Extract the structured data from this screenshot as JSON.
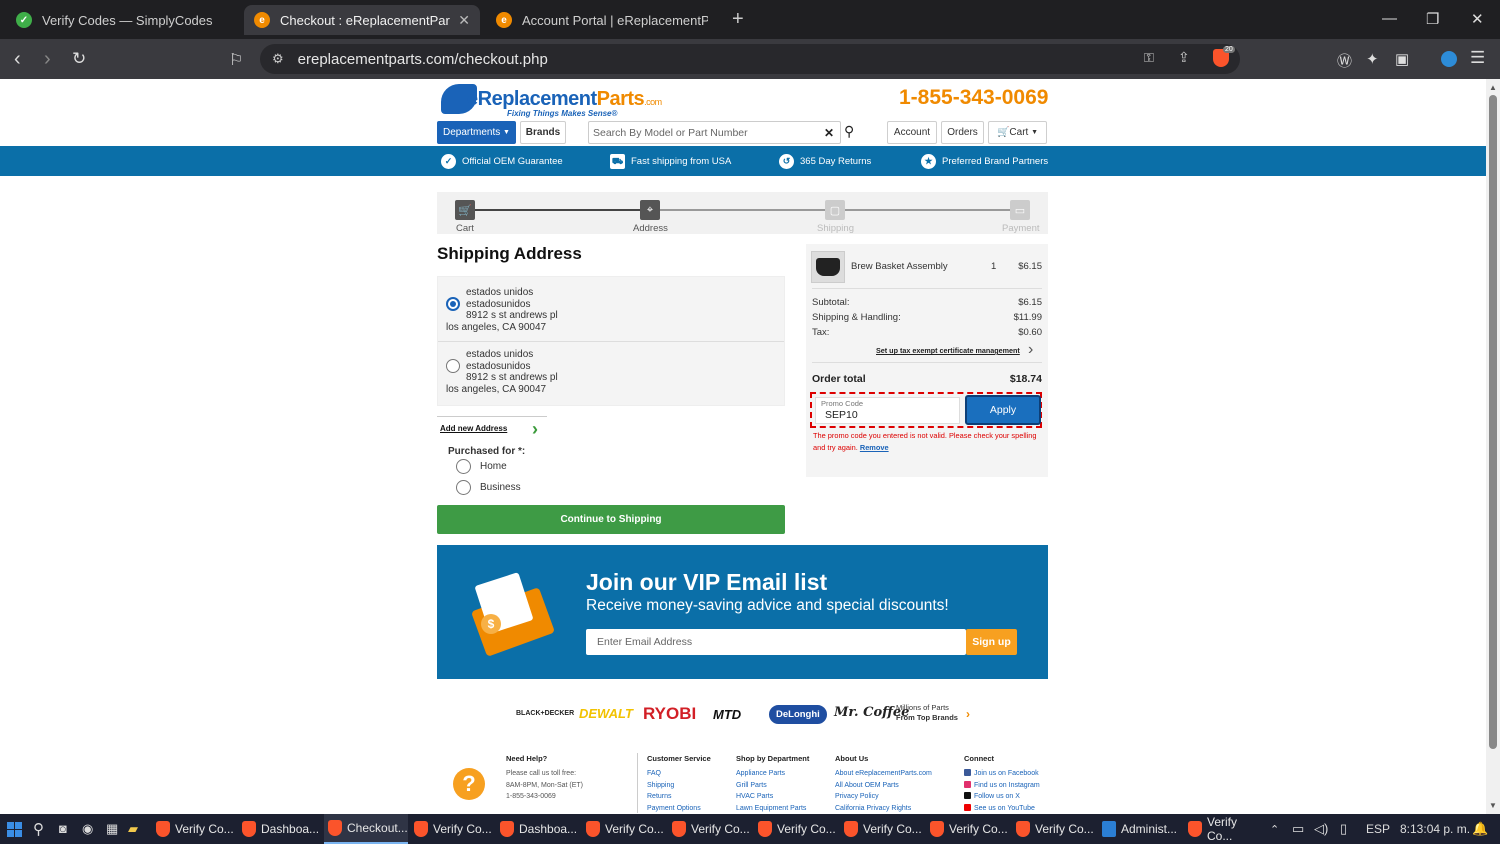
{
  "browser": {
    "tabs": [
      {
        "title": "Verify Codes — SimplyCodes",
        "active": false
      },
      {
        "title": "Checkout : eReplacementParts.c",
        "active": true
      },
      {
        "title": "Account Portal | eReplacementParts.c",
        "active": false
      }
    ],
    "url": "ereplacementparts.com/checkout.php",
    "shield_count": "20"
  },
  "header": {
    "logo_main": "eReplacement",
    "logo_parts": "Parts",
    "logo_com": ".com",
    "logo_tagline": "Fixing Things Makes Sense®",
    "phone": "1-855-343-0069",
    "departments_label": "Departments",
    "brands_label": "Brands",
    "search_placeholder": "Search By Model or Part Number",
    "account_label": "Account",
    "orders_label": "Orders",
    "cart_label": "Cart"
  },
  "benefits": [
    "Official OEM Guarantee",
    "Fast shipping from USA",
    "365 Day Returns",
    "Preferred Brand Partners"
  ],
  "steps": [
    "Cart",
    "Address",
    "Shipping",
    "Payment"
  ],
  "shipping": {
    "heading": "Shipping Address",
    "addresses": [
      {
        "line1": "estados unidos",
        "line2": "estadosunidos",
        "line3": "8912 s st andrews pl",
        "line4": "los angeles, CA 90047",
        "selected": true
      },
      {
        "line1": "estados unidos",
        "line2": "estadosunidos",
        "line3": "8912 s st andrews pl",
        "line4": "los angeles, CA 90047",
        "selected": false
      }
    ],
    "add_new": "Add new Address",
    "purchased_for": "Purchased for *:",
    "options": [
      "Home",
      "Business"
    ],
    "continue_label": "Continue to Shipping"
  },
  "summary": {
    "item_name": "Brew Basket Assembly",
    "item_qty": "1",
    "item_price": "$6.15",
    "subtotal_label": "Subtotal:",
    "subtotal": "$6.15",
    "shipping_label": "Shipping & Handling:",
    "shipping": "$11.99",
    "tax_label": "Tax:",
    "tax": "$0.60",
    "tax_link": "Set up tax exempt certificate management",
    "total_label": "Order total",
    "total": "$18.74",
    "promo_label": "Promo Code",
    "promo_value": "SEP10",
    "apply_label": "Apply",
    "promo_error": "The promo code you entered is not valid. Please check your spelling and try again.",
    "remove_label": "Remove"
  },
  "vip": {
    "heading": "Join our VIP Email list",
    "subheading": "Receive money-saving advice and special discounts!",
    "email_placeholder": "Enter Email Address",
    "signup_label": "Sign up"
  },
  "brands": {
    "names": [
      "BLACK+DECKER",
      "DEWALT",
      "RYOBI",
      "MTD",
      "DeLonghi",
      "Mr. Coffee"
    ],
    "tagline1": "Millions of Parts",
    "tagline2": "From Top Brands"
  },
  "footer": {
    "help_title": "Need Help?",
    "help_lines": [
      "Please call us toll free:",
      "8AM-8PM, Mon-Sat (ET)",
      "1-855-343-0069"
    ],
    "customer_service": {
      "title": "Customer Service",
      "links": [
        "FAQ",
        "Shipping",
        "Returns",
        "Payment Options"
      ]
    },
    "shop": {
      "title": "Shop by Department",
      "links": [
        "Appliance Parts",
        "Grill Parts",
        "HVAC Parts",
        "Lawn Equipment Parts"
      ]
    },
    "about": {
      "title": "About Us",
      "links": [
        "About eReplacementParts.com",
        "All About OEM Parts",
        "Privacy Policy",
        "California Privacy Rights"
      ]
    },
    "connect": {
      "title": "Connect",
      "links": [
        "Join us on Facebook",
        "Find us on Instagram",
        "Follow us on X",
        "See us on YouTube"
      ]
    }
  },
  "taskbar": {
    "apps": [
      "Verify Co...",
      "Dashboa...",
      "Checkout...",
      "Verify Co...",
      "Dashboa...",
      "Verify Co...",
      "Verify Co...",
      "Verify Co...",
      "Verify Co...",
      "Verify Co...",
      "Verify Co...",
      "Administ...",
      "Verify Co..."
    ],
    "language": "ESP",
    "time": "8:13:04 p. m."
  },
  "colors": {
    "brand_blue": "#1a63b8",
    "bar_blue": "#0b6fa8",
    "orange": "#f08a00",
    "green": "#3e9b45",
    "error_red": "#dd0000"
  }
}
